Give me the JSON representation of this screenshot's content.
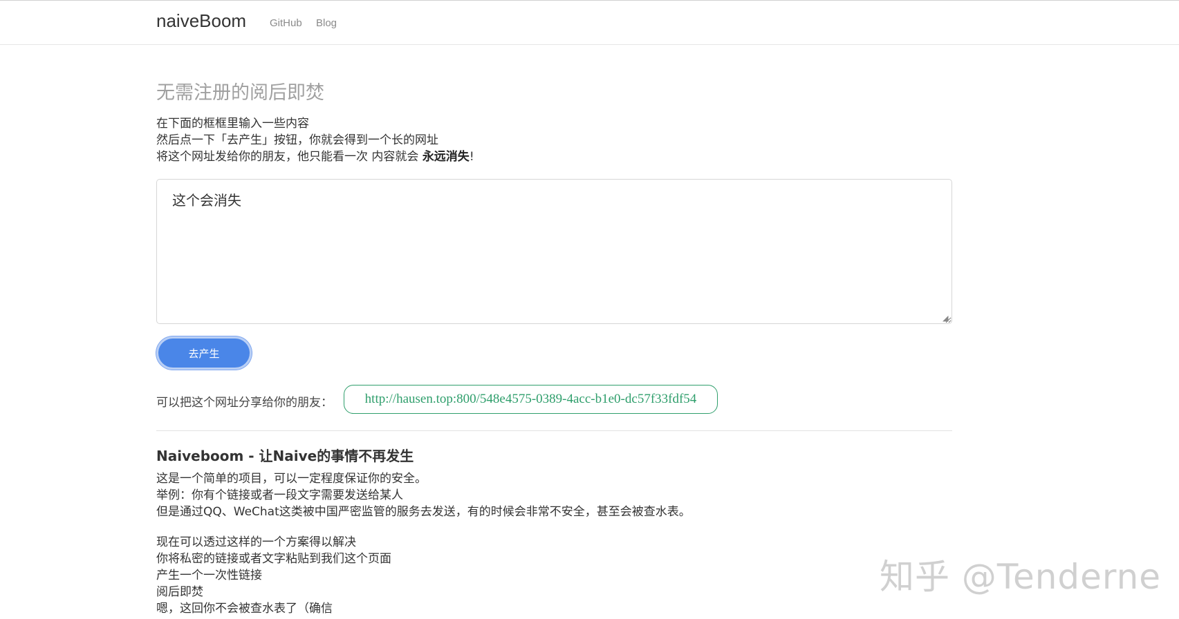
{
  "navbar": {
    "brand": "naiveBoom",
    "links": [
      {
        "label": "GitHub"
      },
      {
        "label": "Blog"
      }
    ]
  },
  "main": {
    "title": "无需注册的阅后即焚",
    "intro": {
      "line1": "在下面的框框里输入一些内容",
      "line2": "然后点一下「去产生」按钮，你就会得到一个长的网址",
      "line3_prefix": "将这个网址发给你的朋友，他只能看一次 内容就会 ",
      "line3_bold": "永远消失",
      "line3_suffix": "!"
    },
    "message_value": "这个会消失",
    "generate_button": "去产生",
    "share_label": "可以把这个网址分享给你的朋友：",
    "share_url": "http://hausen.top:800/548e4575-0389-4acc-b1e0-dc57f33fdf54"
  },
  "about": {
    "heading": "Naiveboom - 让Naive的事情不再发生",
    "paragraph1": [
      "这是一个简单的项目，可以一定程度保证你的安全。",
      "举例：你有个链接或者一段文字需要发送给某人",
      "但是通过QQ、WeChat这类被中国严密监管的服务去发送，有的时候会非常不安全，甚至会被查水表。"
    ],
    "paragraph2": [
      "现在可以透过这样的一个方案得以解决",
      "你将私密的链接或者文字粘贴到我们这个页面",
      "产生一个一次性链接",
      "阅后即焚",
      "嗯，这回你不会被查水表了（确信"
    ]
  },
  "watermark": "知乎 @Tenderne"
}
